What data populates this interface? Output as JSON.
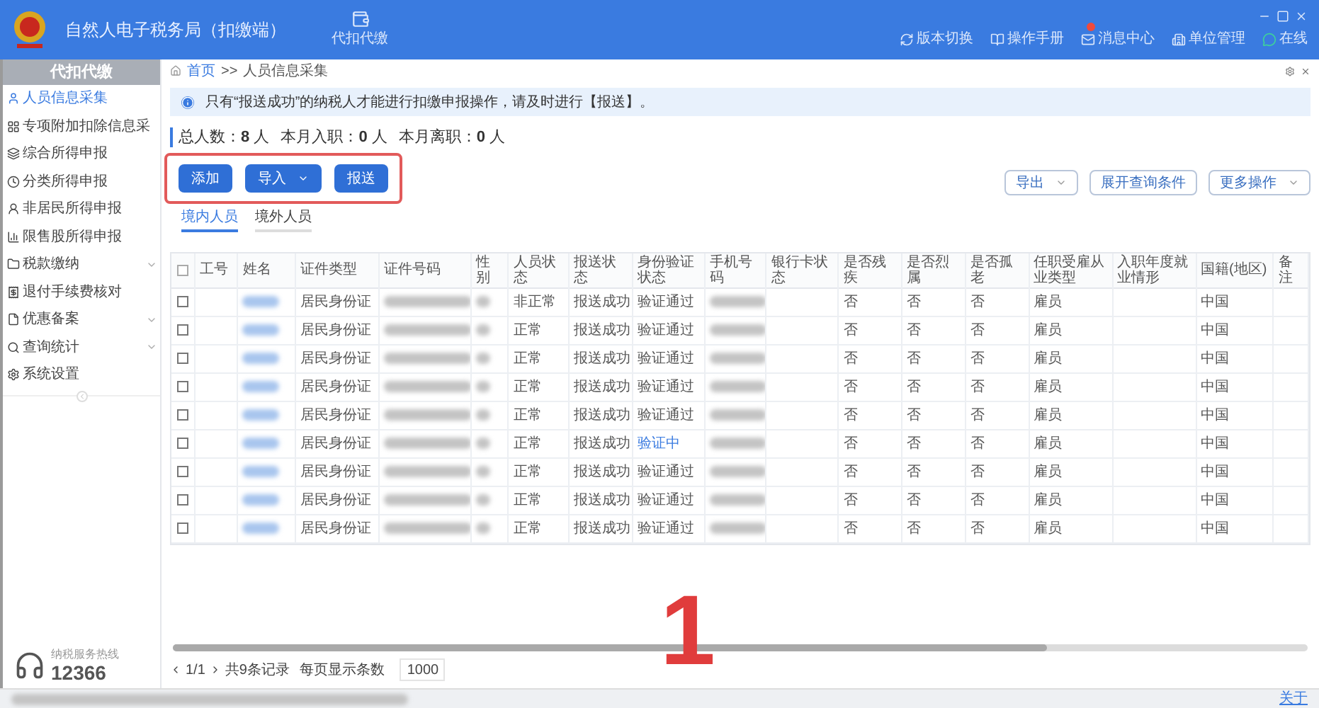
{
  "app": {
    "title": "自然人电子税务局（扣缴端）",
    "module_tab": "代扣代缴"
  },
  "header_links": [
    {
      "kind": "switch",
      "label": "版本切换"
    },
    {
      "kind": "manual",
      "label": "操作手册"
    },
    {
      "kind": "message",
      "label": "消息中心"
    },
    {
      "kind": "org",
      "label": "单位管理"
    },
    {
      "kind": "online",
      "label": "在线"
    }
  ],
  "sidebar": {
    "title": "代扣代缴",
    "items": [
      {
        "label": "人员信息采集",
        "selected": true,
        "expandable": false
      },
      {
        "label": "专项附加扣除信息采",
        "selected": false,
        "expandable": false
      },
      {
        "label": "综合所得申报",
        "selected": false,
        "expandable": false
      },
      {
        "label": "分类所得申报",
        "selected": false,
        "expandable": false
      },
      {
        "label": "非居民所得申报",
        "selected": false,
        "expandable": false
      },
      {
        "label": "限售股所得申报",
        "selected": false,
        "expandable": false
      },
      {
        "label": "税款缴纳",
        "selected": false,
        "expandable": true
      },
      {
        "label": "退付手续费核对",
        "selected": false,
        "expandable": false
      },
      {
        "label": "优惠备案",
        "selected": false,
        "expandable": true
      },
      {
        "label": "查询统计",
        "selected": false,
        "expandable": true
      },
      {
        "label": "系统设置",
        "selected": false,
        "expandable": false
      }
    ],
    "hotline_caption": "纳税服务热线",
    "hotline": "12366"
  },
  "breadcrumb": [
    "首页",
    ">>",
    "人员信息采集"
  ],
  "notice": "只有“报送成功”的纳税人才能进行扣缴申报操作，请及时进行【报送】。",
  "stats": [
    {
      "label": "总人数：",
      "value": "8",
      "unit": "人"
    },
    {
      "label": "本月入职：",
      "value": "0",
      "unit": "人"
    },
    {
      "label": "本月离职：",
      "value": "0",
      "unit": "人"
    }
  ],
  "actions": [
    {
      "label": "添加",
      "dropdown": false
    },
    {
      "label": "导入",
      "dropdown": true
    },
    {
      "label": "报送",
      "dropdown": false
    }
  ],
  "tools": [
    {
      "label": "导出",
      "dropdown": true
    },
    {
      "label": "展开查询条件",
      "dropdown": false
    },
    {
      "label": "更多操作",
      "dropdown": true
    }
  ],
  "tabs": [
    {
      "label": "境内人员",
      "selected": true
    },
    {
      "label": "境外人员",
      "selected": false
    }
  ],
  "table": {
    "select_all_checked": false,
    "columns": [
      "工号",
      "姓名",
      "证件类型",
      "证件号码",
      "性别",
      "人员状态",
      "报送状态",
      "身份验证状态",
      "手机号码",
      "银行卡状态",
      "是否残疾",
      "是否烈属",
      "是否孤老",
      "任职受雇从业类型",
      "入职年度就业情形",
      "国籍(地区)",
      "备注"
    ],
    "rows": [
      {
        "checked": false,
        "id_type": "居民身份证",
        "status": "非正常",
        "report": "报送成功",
        "verify": "验证通过",
        "verifying": false,
        "disabled_person": "否",
        "martyr": "否",
        "elder": "否",
        "employment": "雇员",
        "country": "中国"
      },
      {
        "checked": false,
        "id_type": "居民身份证",
        "status": "正常",
        "report": "报送成功",
        "verify": "验证通过",
        "verifying": false,
        "disabled_person": "否",
        "martyr": "否",
        "elder": "否",
        "employment": "雇员",
        "country": "中国"
      },
      {
        "checked": false,
        "id_type": "居民身份证",
        "status": "正常",
        "report": "报送成功",
        "verify": "验证通过",
        "verifying": false,
        "disabled_person": "否",
        "martyr": "否",
        "elder": "否",
        "employment": "雇员",
        "country": "中国"
      },
      {
        "checked": false,
        "id_type": "居民身份证",
        "status": "正常",
        "report": "报送成功",
        "verify": "验证通过",
        "verifying": false,
        "disabled_person": "否",
        "martyr": "否",
        "elder": "否",
        "employment": "雇员",
        "country": "中国"
      },
      {
        "checked": false,
        "id_type": "居民身份证",
        "status": "正常",
        "report": "报送成功",
        "verify": "验证通过",
        "verifying": false,
        "disabled_person": "否",
        "martyr": "否",
        "elder": "否",
        "employment": "雇员",
        "country": "中国"
      },
      {
        "checked": false,
        "id_type": "居民身份证",
        "status": "正常",
        "report": "报送成功",
        "verify": "验证中",
        "verifying": true,
        "disabled_person": "否",
        "martyr": "否",
        "elder": "否",
        "employment": "雇员",
        "country": "中国"
      },
      {
        "checked": false,
        "id_type": "居民身份证",
        "status": "正常",
        "report": "报送成功",
        "verify": "验证通过",
        "verifying": false,
        "disabled_person": "否",
        "martyr": "否",
        "elder": "否",
        "employment": "雇员",
        "country": "中国"
      },
      {
        "checked": false,
        "id_type": "居民身份证",
        "status": "正常",
        "report": "报送成功",
        "verify": "验证通过",
        "verifying": false,
        "disabled_person": "否",
        "martyr": "否",
        "elder": "否",
        "employment": "雇员",
        "country": "中国"
      },
      {
        "checked": false,
        "id_type": "居民身份证",
        "status": "正常",
        "report": "报送成功",
        "verify": "验证通过",
        "verifying": false,
        "disabled_person": "否",
        "martyr": "否",
        "elder": "否",
        "employment": "雇员",
        "country": "中国"
      }
    ]
  },
  "pagination": {
    "page": "1/1",
    "total": "共9条记录",
    "per_page_label": "每页显示条数",
    "per_page": "1000"
  },
  "annotation": {
    "label": "1"
  },
  "status_bar": {
    "link": "关于"
  }
}
